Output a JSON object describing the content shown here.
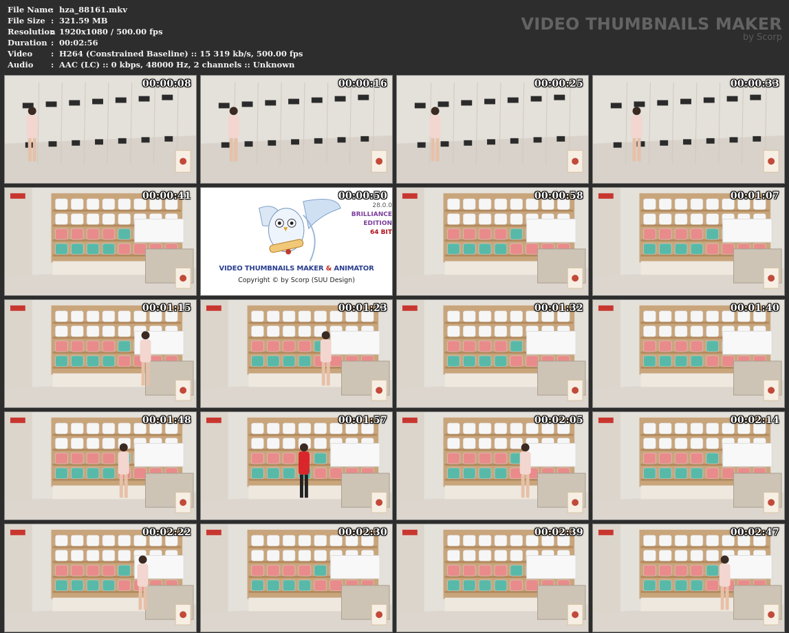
{
  "header": {
    "rows": [
      {
        "key": "File Name",
        "value": "hza_88161.mkv"
      },
      {
        "key": "File Size",
        "value": "321.59 MB"
      },
      {
        "key": "Resolution",
        "value": "1920x1080 / 500.00 fps"
      },
      {
        "key": "Duration",
        "value": "00:02:56"
      },
      {
        "key": "Video",
        "value": "H264 (Constrained Baseline) :: 15 319 kb/s, 500.00 fps"
      },
      {
        "key": "Audio",
        "value": "AAC (LC) :: 0 kbps, 48000 Hz, 2 channels :: Unknown"
      }
    ],
    "separator": ":"
  },
  "brand": {
    "title": "VIDEO THUMBNAILS MAKER",
    "subtitle": "by Scorp"
  },
  "thumbnails": [
    {
      "time": "00:00:08",
      "scene": "lockers-person"
    },
    {
      "time": "00:00:16",
      "scene": "lockers-person"
    },
    {
      "time": "00:00:25",
      "scene": "lockers-person"
    },
    {
      "time": "00:00:33",
      "scene": "lockers-person"
    },
    {
      "time": "00:00:41",
      "scene": "shelves"
    },
    {
      "time": "00:00:50",
      "scene": "logo"
    },
    {
      "time": "00:00:58",
      "scene": "shelves"
    },
    {
      "time": "00:01:07",
      "scene": "shelves"
    },
    {
      "time": "00:01:15",
      "scene": "shelves-person"
    },
    {
      "time": "00:01:23",
      "scene": "shelves-person"
    },
    {
      "time": "00:01:32",
      "scene": "shelves"
    },
    {
      "time": "00:01:40",
      "scene": "shelves"
    },
    {
      "time": "00:01:48",
      "scene": "shelves-person"
    },
    {
      "time": "00:01:57",
      "scene": "shelves-person-red"
    },
    {
      "time": "00:02:05",
      "scene": "shelves-person"
    },
    {
      "time": "00:02:14",
      "scene": "shelves"
    },
    {
      "time": "00:02:22",
      "scene": "shelves-person"
    },
    {
      "time": "00:02:30",
      "scene": "shelves"
    },
    {
      "time": "00:02:39",
      "scene": "shelves"
    },
    {
      "time": "00:02:47",
      "scene": "shelves-person"
    }
  ],
  "logo": {
    "title_a": "VIDEO THUMBNAILS MAKER",
    "title_amp": " & ",
    "title_b": "ANIMATOR",
    "copyright": "Copyright © by Scorp (SUU Design)",
    "version": "28.0.0",
    "edition_1": "BRILLIANCE",
    "edition_2": "EDITION",
    "edition_3": "64 BIT"
  },
  "colors": {
    "background": "#2d2d2d",
    "header_text": "#f2f2f2",
    "brand_text": "#636363",
    "timestamp": "#ffffff",
    "wall": "#e4e0da",
    "shelf_wood": "#c9a57c",
    "towel_pink": "#e98b8b",
    "towel_teal": "#59b9a8",
    "towel_white": "#f6f6f6",
    "locker_black": "#2b2b2b"
  }
}
